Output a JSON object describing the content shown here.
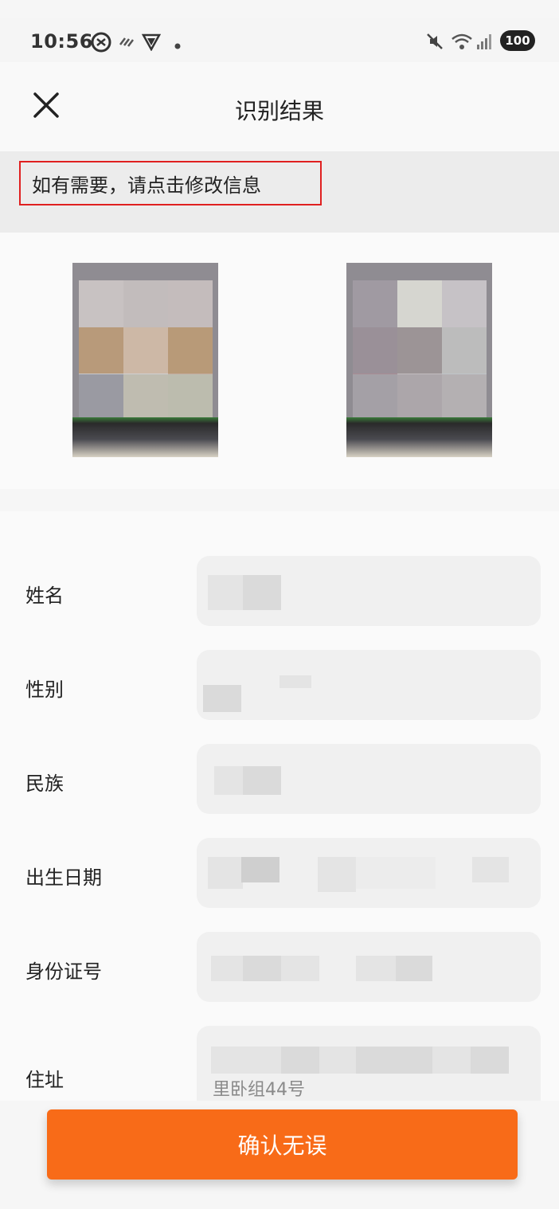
{
  "status_bar": {
    "time": "10:56",
    "battery": "100",
    "icons": [
      "vpn-icon",
      "signal-waves-icon",
      "shield-icon",
      "dot-icon",
      "mute-icon",
      "wifi-icon",
      "cell-signal-icon",
      "battery-icon"
    ]
  },
  "nav": {
    "title": "识别结果",
    "close_icon": "close-icon"
  },
  "hint": {
    "text": "如有需要，请点击修改信息",
    "highlight_color": "#e02020"
  },
  "images": {
    "front_label": "",
    "back_label": ""
  },
  "form": {
    "fields": [
      {
        "label": "姓名",
        "value": ""
      },
      {
        "label": "性别",
        "value": ""
      },
      {
        "label": "民族",
        "value": ""
      },
      {
        "label": "出生日期",
        "value": ""
      },
      {
        "label": "身份证号",
        "value": ""
      },
      {
        "label": "住址",
        "value": "",
        "visible_fragment": "里卧组44号"
      }
    ]
  },
  "actions": {
    "confirm_label": "确认无误",
    "accent_color": "#f86b18"
  }
}
